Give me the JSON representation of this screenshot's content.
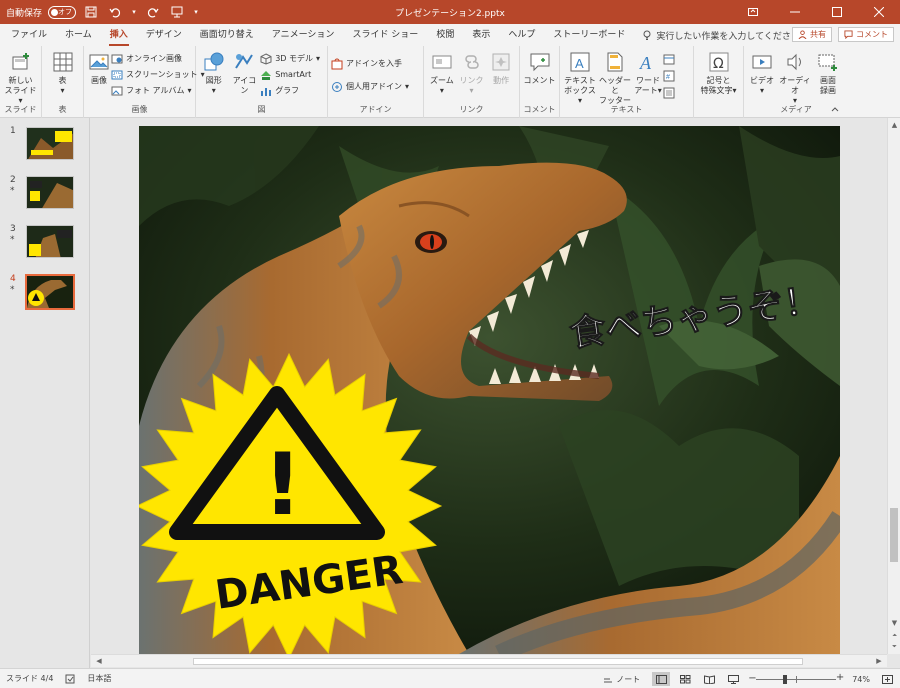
{
  "titlebar": {
    "autosave_label": "自動保存",
    "autosave_state": "オフ",
    "doc_title": "プレゼンテーション2.pptx"
  },
  "tabs": [
    {
      "label": "ファイル",
      "active": false
    },
    {
      "label": "ホーム",
      "active": false
    },
    {
      "label": "挿入",
      "active": true
    },
    {
      "label": "デザイン",
      "active": false
    },
    {
      "label": "画面切り替え",
      "active": false
    },
    {
      "label": "アニメーション",
      "active": false
    },
    {
      "label": "スライド ショー",
      "active": false
    },
    {
      "label": "校閲",
      "active": false
    },
    {
      "label": "表示",
      "active": false
    },
    {
      "label": "ヘルプ",
      "active": false
    },
    {
      "label": "ストーリーボード",
      "active": false
    }
  ],
  "tellme": "実行したい作業を入力してください",
  "share": {
    "share_label": "共有",
    "comment_label": "コメント"
  },
  "ribbon": {
    "slides": {
      "new_slide_1": "新しい",
      "new_slide_2": "スライド",
      "label": "スライド"
    },
    "tables": {
      "table": "表",
      "label": "表"
    },
    "images": {
      "picture": "画像",
      "online": "オンライン画像",
      "screenshot": "スクリーンショット",
      "album": "フォト アルバム",
      "label": "画像"
    },
    "illustrations": {
      "shapes": "図形",
      "icons": "アイコン",
      "model3d": "3D モデル",
      "smartart": "SmartArt",
      "chart": "グラフ",
      "label": "図"
    },
    "addins": {
      "get": "アドインを入手",
      "my": "個人用アドイン",
      "label": "アドイン"
    },
    "links": {
      "zoom": "ズーム",
      "link": "リンク",
      "action": "動作",
      "label": "リンク"
    },
    "comments": {
      "comment": "コメント",
      "label": "コメント"
    },
    "text": {
      "textbox_1": "テキスト",
      "textbox_2": "ボックス",
      "header_1": "ヘッダーと",
      "header_2": "フッター",
      "wordart_1": "ワード",
      "wordart_2": "アート",
      "label": "テキスト"
    },
    "symbols": {
      "symbol_1": "記号と",
      "symbol_2": "特殊文字",
      "label": ""
    },
    "media": {
      "video": "ビデオ",
      "audio": "オーディオ",
      "record_1": "画面",
      "record_2": "録画",
      "label": "メディア"
    }
  },
  "thumbnails": [
    {
      "num": "1",
      "star": "",
      "active": false
    },
    {
      "num": "2",
      "star": "*",
      "active": false
    },
    {
      "num": "3",
      "star": "*",
      "active": false
    },
    {
      "num": "4",
      "star": "*",
      "active": true
    }
  ],
  "slide": {
    "caption": "食べちゃうぞ！",
    "warning_text": "DANGER",
    "exclamation": "!"
  },
  "statusbar": {
    "slide_info": "スライド 4/4",
    "language": "日本語",
    "notes": "ノート",
    "zoom": "74%"
  },
  "colors": {
    "accent": "#b7472a",
    "starburst": "#ffe600",
    "thumb_active_border": "#e86a3d"
  }
}
